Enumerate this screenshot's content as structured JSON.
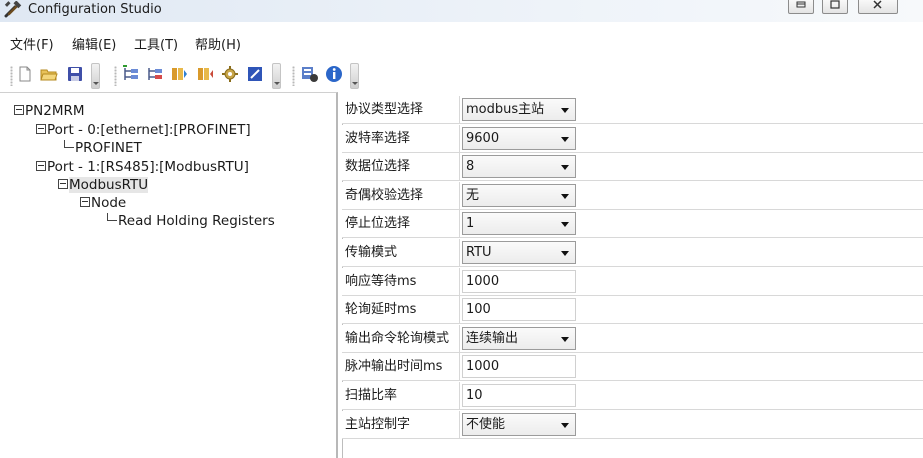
{
  "window": {
    "title": "Configuration Studio"
  },
  "menu": [
    {
      "label": "文件(F)"
    },
    {
      "label": "编辑(E)"
    },
    {
      "label": "工具(T)"
    },
    {
      "label": "帮助(H)"
    }
  ],
  "toolbar": {
    "icons": [
      "new-file-icon",
      "open-folder-icon",
      "save-icon",
      "add-tree-icon",
      "remove-tree-icon",
      "import-icon",
      "export-icon",
      "settings-gear-icon",
      "edit-icon",
      "config-wizard-icon",
      "info-icon"
    ]
  },
  "tree": {
    "root": "PN2MRM",
    "port0": "Port - 0:[ethernet]:[PROFINET]",
    "profinet": "PROFINET",
    "port1": "Port - 1:[RS485]:[ModbusRTU]",
    "modbusrtu": "ModbusRTU",
    "node": "Node",
    "register": "Read Holding Registers"
  },
  "properties": [
    {
      "label": "协议类型选择",
      "value": "modbus主站",
      "type": "combo"
    },
    {
      "label": "波特率选择",
      "value": "9600",
      "type": "combo"
    },
    {
      "label": "数据位选择",
      "value": "8",
      "type": "combo"
    },
    {
      "label": "奇偶校验选择",
      "value": "无",
      "type": "combo"
    },
    {
      "label": "停止位选择",
      "value": "1",
      "type": "combo"
    },
    {
      "label": "传输模式",
      "value": "RTU",
      "type": "combo"
    },
    {
      "label": "响应等待ms",
      "value": "1000",
      "type": "text"
    },
    {
      "label": "轮询延时ms",
      "value": "100",
      "type": "text"
    },
    {
      "label": "输出命令轮询模式",
      "value": "连续输出",
      "type": "combo"
    },
    {
      "label": "脉冲输出时间ms",
      "value": "1000",
      "type": "text"
    },
    {
      "label": "扫描比率",
      "value": "10",
      "type": "text"
    },
    {
      "label": "主站控制字",
      "value": "不使能",
      "type": "combo"
    }
  ]
}
